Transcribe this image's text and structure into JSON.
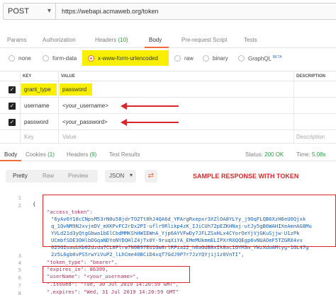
{
  "request": {
    "method": "POST",
    "url": "https://webapi.acmaweb.org/token"
  },
  "request_tabs": [
    {
      "label": "Params"
    },
    {
      "label": "Authorization"
    },
    {
      "label": "Headers",
      "count": "(10)"
    },
    {
      "label": "Body",
      "active": true
    },
    {
      "label": "Pre-request Script"
    },
    {
      "label": "Tests"
    }
  ],
  "body_types": [
    {
      "label": "none"
    },
    {
      "label": "form-data"
    },
    {
      "label": "x-www-form-urlencoded",
      "selected": true
    },
    {
      "label": "raw"
    },
    {
      "label": "binary"
    },
    {
      "label": "GraphQL",
      "badge": "BETA"
    }
  ],
  "table": {
    "headers": {
      "key": "KEY",
      "value": "VALUE",
      "description": "DESCRIPTION"
    },
    "rows": [
      {
        "key": "grant_type",
        "value": "password"
      },
      {
        "key": "username",
        "value": "<your_username>"
      },
      {
        "key": "password",
        "value": "<your_password>"
      }
    ],
    "placeholder": {
      "key": "Key",
      "value": "Value",
      "description": "Description"
    }
  },
  "response_tabs": [
    {
      "label": "Body",
      "active": true
    },
    {
      "label": "Cookies",
      "count": "(1)"
    },
    {
      "label": "Headers",
      "count": "(9)"
    },
    {
      "label": "Test Results"
    }
  ],
  "status": {
    "status_label": "Status:",
    "status_value": "200 OK",
    "time_label": "Time:",
    "time_value": "5.08s"
  },
  "view_modes": [
    "Pretty",
    "Raw",
    "Preview"
  ],
  "format": "JSON",
  "annotation": "SAMPLE RESPONSE WITH TOKEN",
  "response_lines": [
    {
      "n": "1",
      "t": "{"
    },
    {
      "n": "2",
      "t": "\"access_token\":"
    },
    {
      "n": "",
      "t": "\"6yAv6Y18cCNpsM53rN0u58jdrTO2Tt8hJ4QA6d_YPArgRxepxr3XZlOA8YLYy_j9OqFLQB6XzH6eUOQjxk"
    },
    {
      "n": "",
      "t": "q_1QvNM9NJxvjeDV_mXKPvFC2rDx2PI-uflr9Rlikp4zK_IJiCUh72pEZKHNaj-utJy5gB6WAHIXeAmnAG8Mu"
    },
    {
      "n": "",
      "t": "YVLd21d3yQtgGbwa1bElCbdMMKShHWIEWnA_Yjp6AYVFwDy7JFLZSxHLx4CYorOeYjVjGKuSjjw-U1zPk"
    },
    {
      "n": "",
      "t": "UCmbfSDE3OHlbDGqaNDYoNYDQHlZ4jTx0Y-9ruqXiYA_EMeMUkmmELIPXrRXQQEgp6vNUAOeF5TZGRX4vv"
    },
    {
      "n": "",
      "t": "025GIuaubXb62dzda7CL8Plrw7N0B97EU1Gw8rlRPia22_h6aGdB8xIk8ac1GYM3m_YWzXdoAMtyg-1GL47g"
    },
    {
      "n": "",
      "t": "2z5L6gb0vPS5rwYiVuP2_lLhCme40BCiD4xqT7GdJ9P7r7JzYQYjij1z0VnTI\","
    },
    {
      "n": "3",
      "t": "\"token_type\": \"bearer\","
    },
    {
      "n": "4",
      "t": "\"expires_in\": 86399,"
    },
    {
      "n": "5",
      "t": "\"userName\": \"<your_username>\","
    },
    {
      "n": "6",
      "t": "\".issued\": \"Tue, 30 Jul 2019 14:20:59 GMT\","
    },
    {
      "n": "7",
      "t": "\".expires\": \"Wed, 31 Jul 2019 14:20:59 GMT\""
    },
    {
      "n": "8",
      "t": "}"
    }
  ],
  "colors": {
    "accent": "#f26b3a",
    "highlight": "#f8f000",
    "annotation_red": "#d8262a",
    "status_green": "#2a9c3e"
  }
}
